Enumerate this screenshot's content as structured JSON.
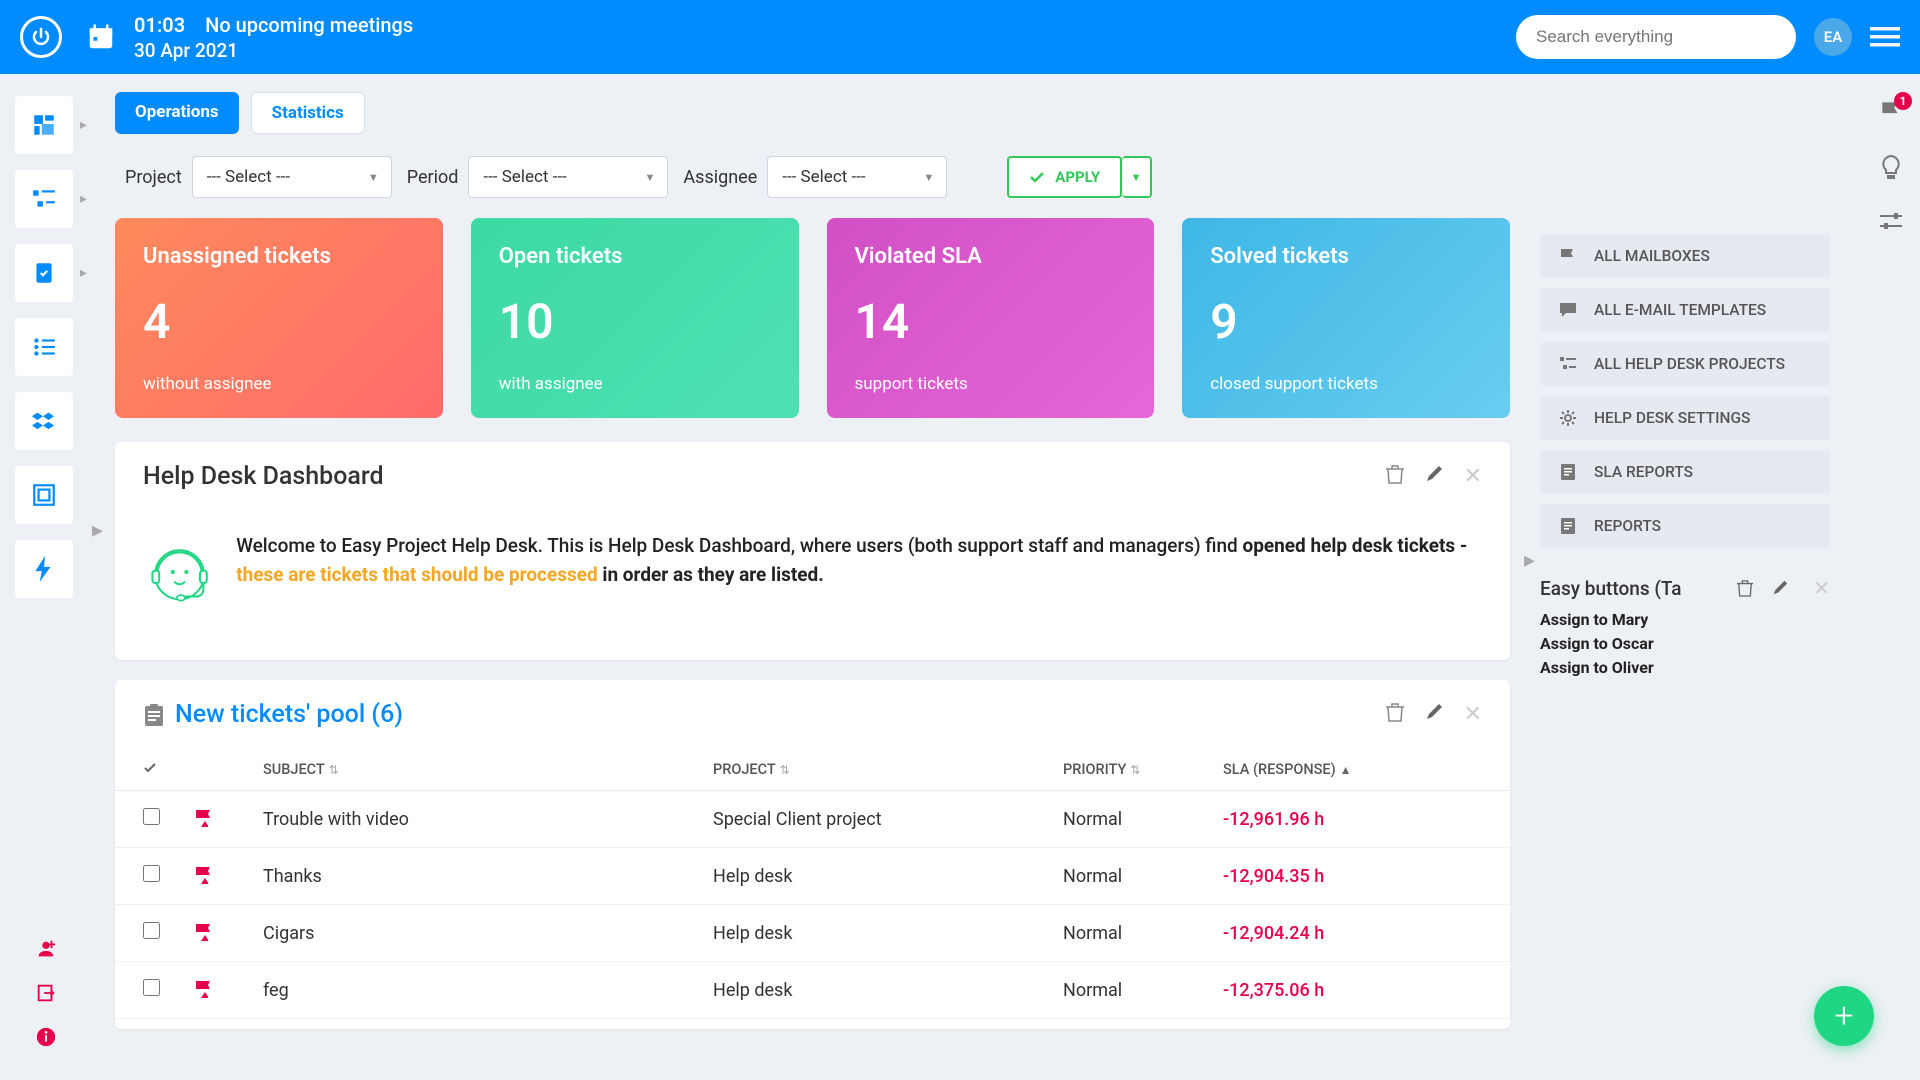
{
  "header": {
    "time": "01:03",
    "meeting": "No upcoming meetings",
    "date": "30 Apr 2021",
    "search_placeholder": "Search everything",
    "avatar": "EA"
  },
  "tabs": {
    "operations": "Operations",
    "statistics": "Statistics"
  },
  "filters": {
    "project_label": "Project",
    "period_label": "Period",
    "assignee_label": "Assignee",
    "select_placeholder": "--- Select ---",
    "apply": "APPLY"
  },
  "cards": [
    {
      "title": "Unassigned tickets",
      "value": "4",
      "sub": "without assignee"
    },
    {
      "title": "Open tickets",
      "value": "10",
      "sub": "with assignee"
    },
    {
      "title": "Violated SLA",
      "value": "14",
      "sub": "support tickets"
    },
    {
      "title": "Solved tickets",
      "value": "9",
      "sub": "closed support tickets"
    }
  ],
  "dashboard": {
    "title": "Help Desk Dashboard",
    "welcome_pre": "Welcome to Easy Project Help Desk. This is Help Desk Dashboard, where users (both support staff and managers) find ",
    "welcome_bold": "opened help desk tickets - ",
    "welcome_orange": "these are tickets that should be processed",
    "welcome_post": " in order as they are listed."
  },
  "pool": {
    "title": "New tickets' pool (6)",
    "cols": {
      "subject": "SUBJECT",
      "project": "PROJECT",
      "priority": "PRIORITY",
      "sla": "SLA (RESPONSE)"
    },
    "rows": [
      {
        "subject": "Trouble with video",
        "project": "Special Client project",
        "priority": "Normal",
        "sla": "-12,961.96 h"
      },
      {
        "subject": "Thanks",
        "project": "Help desk",
        "priority": "Normal",
        "sla": "-12,904.35 h"
      },
      {
        "subject": "Cigars",
        "project": "Help desk",
        "priority": "Normal",
        "sla": "-12,904.24 h"
      },
      {
        "subject": "feg",
        "project": "Help desk",
        "priority": "Normal",
        "sla": "-12,375.06 h"
      }
    ]
  },
  "rightLinks": [
    {
      "label": "ALL MAILBOXES"
    },
    {
      "label": "ALL E-MAIL TEMPLATES"
    },
    {
      "label": "ALL HELP DESK PROJECTS"
    },
    {
      "label": "HELP DESK SETTINGS"
    },
    {
      "label": "SLA REPORTS"
    },
    {
      "label": "REPORTS"
    }
  ],
  "easy": {
    "title": "Easy buttons (Ta",
    "items": [
      "Assign to Mary",
      "Assign to Oscar",
      "Assign to Oliver"
    ]
  },
  "notif_badge": "1"
}
